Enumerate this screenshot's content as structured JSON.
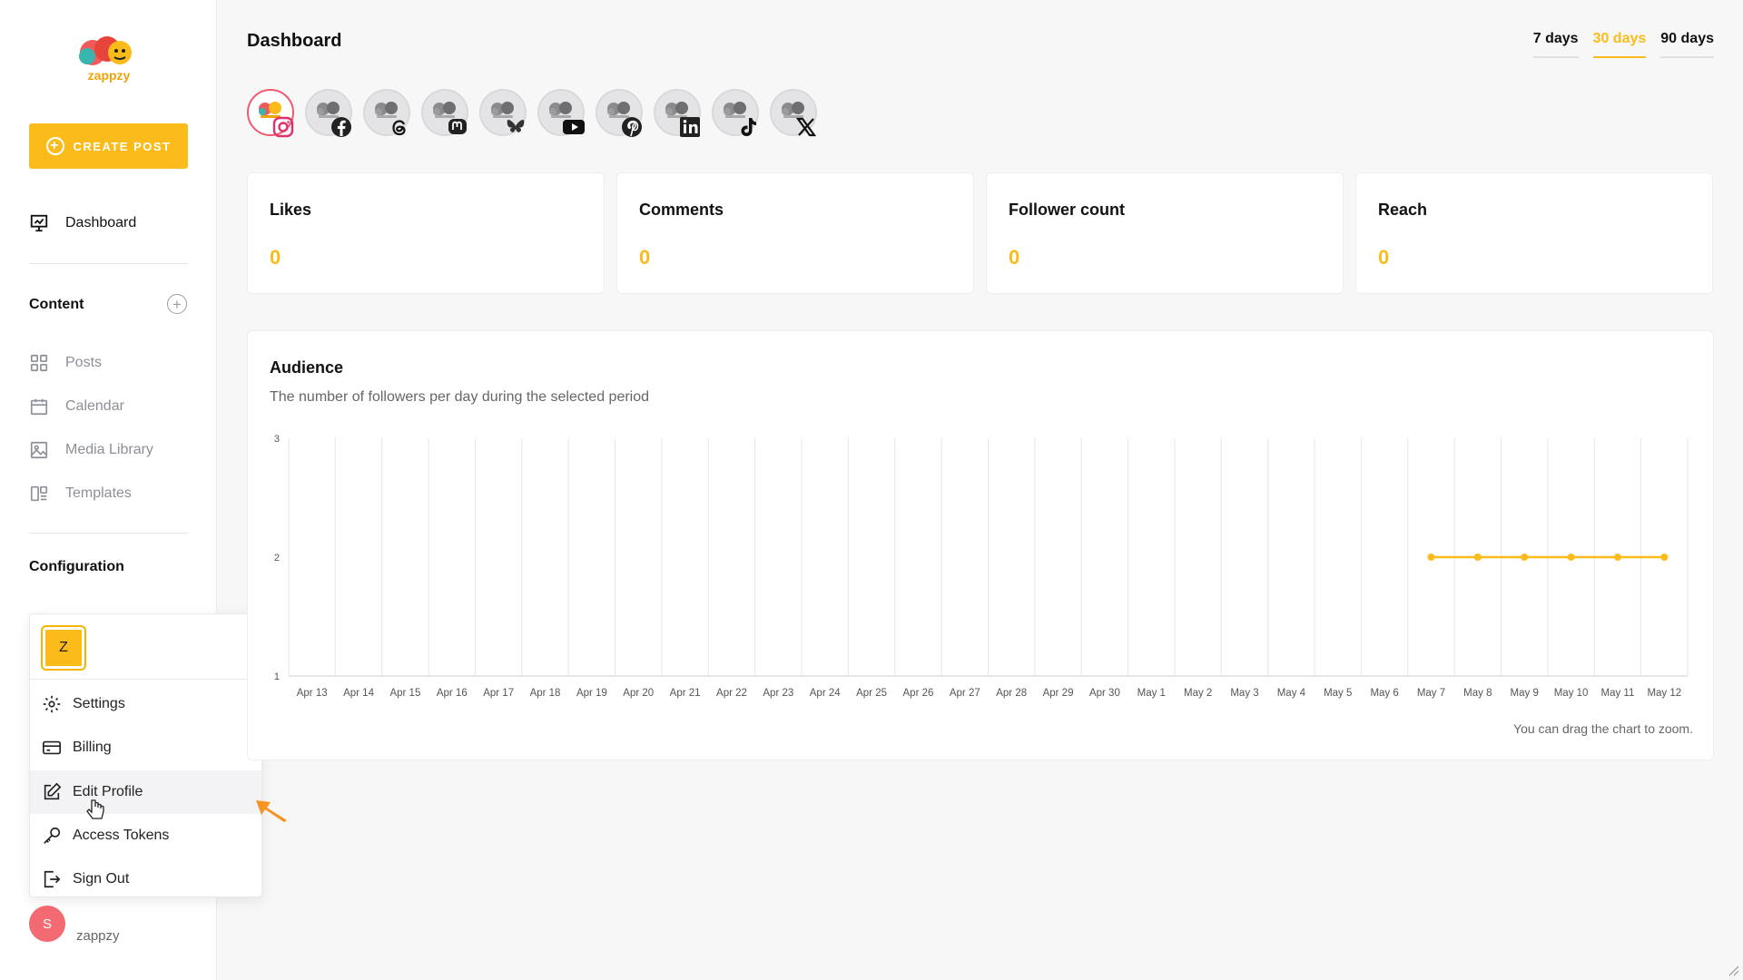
{
  "brand": {
    "logo_text": "zappzy"
  },
  "sidebar": {
    "create_label": "CREATE POST",
    "dashboard_label": "Dashboard",
    "content_title": "Content",
    "items": [
      {
        "label": "Posts",
        "icon": "grid-icon"
      },
      {
        "label": "Calendar",
        "icon": "calendar-icon"
      },
      {
        "label": "Media Library",
        "icon": "image-icon"
      },
      {
        "label": "Templates",
        "icon": "templates-icon"
      }
    ],
    "config_title": "Configuration"
  },
  "menu": {
    "avatar_letter": "Z",
    "items": [
      {
        "label": "Settings",
        "icon": "gear-icon"
      },
      {
        "label": "Billing",
        "icon": "credit-card-icon"
      },
      {
        "label": "Edit Profile",
        "icon": "edit-icon"
      },
      {
        "label": "Access Tokens",
        "icon": "key-icon"
      },
      {
        "label": "Sign Out",
        "icon": "sign-out-icon"
      }
    ]
  },
  "user": {
    "avatar_letter": "S",
    "name": "zappzy"
  },
  "header": {
    "title": "Dashboard",
    "periods": [
      "7 days",
      "30 days",
      "90 days"
    ],
    "active_period": "30 days"
  },
  "accounts": [
    {
      "platform": "Instagram",
      "icon": "instagram-icon",
      "selected": true
    },
    {
      "platform": "Facebook",
      "icon": "facebook-icon"
    },
    {
      "platform": "Threads",
      "icon": "threads-icon"
    },
    {
      "platform": "Mastodon",
      "icon": "mastodon-icon"
    },
    {
      "platform": "Bluesky",
      "icon": "bluesky-icon"
    },
    {
      "platform": "YouTube",
      "icon": "youtube-icon"
    },
    {
      "platform": "Pinterest",
      "icon": "pinterest-icon"
    },
    {
      "platform": "LinkedIn",
      "icon": "linkedin-icon"
    },
    {
      "platform": "TikTok",
      "icon": "tiktok-icon"
    },
    {
      "platform": "X",
      "icon": "x-icon"
    }
  ],
  "stats": [
    {
      "label": "Likes",
      "value": "0"
    },
    {
      "label": "Comments",
      "value": "0"
    },
    {
      "label": "Follower count",
      "value": "0"
    },
    {
      "label": "Reach",
      "value": "0"
    }
  ],
  "audience": {
    "title": "Audience",
    "subtitle": "The number of followers per day during the selected period",
    "note": "You can drag the chart to zoom."
  },
  "colors": {
    "accent": "#fbbc1b",
    "avatar": "#f46a72",
    "instagram_ring": "#f05a6e"
  },
  "chart_data": {
    "type": "line",
    "title": "Audience",
    "x": [
      "Apr 13",
      "Apr 14",
      "Apr 15",
      "Apr 16",
      "Apr 17",
      "Apr 18",
      "Apr 19",
      "Apr 20",
      "Apr 21",
      "Apr 22",
      "Apr 23",
      "Apr 24",
      "Apr 25",
      "Apr 26",
      "Apr 27",
      "Apr 28",
      "Apr 29",
      "Apr 30",
      "May 1",
      "May 2",
      "May 3",
      "May 4",
      "May 5",
      "May 6",
      "May 7",
      "May 8",
      "May 9",
      "May 10",
      "May 11",
      "May 12"
    ],
    "series": [
      {
        "values": [
          null,
          null,
          null,
          null,
          null,
          null,
          null,
          null,
          null,
          null,
          null,
          null,
          null,
          null,
          null,
          null,
          null,
          null,
          null,
          null,
          null,
          null,
          null,
          null,
          2,
          2,
          2,
          2,
          2,
          2
        ],
        "color": "#fbbc1b"
      }
    ],
    "y_ticks": [
      1,
      2,
      3
    ],
    "ylim": [
      1,
      3
    ],
    "grid": true,
    "legend": "none"
  }
}
